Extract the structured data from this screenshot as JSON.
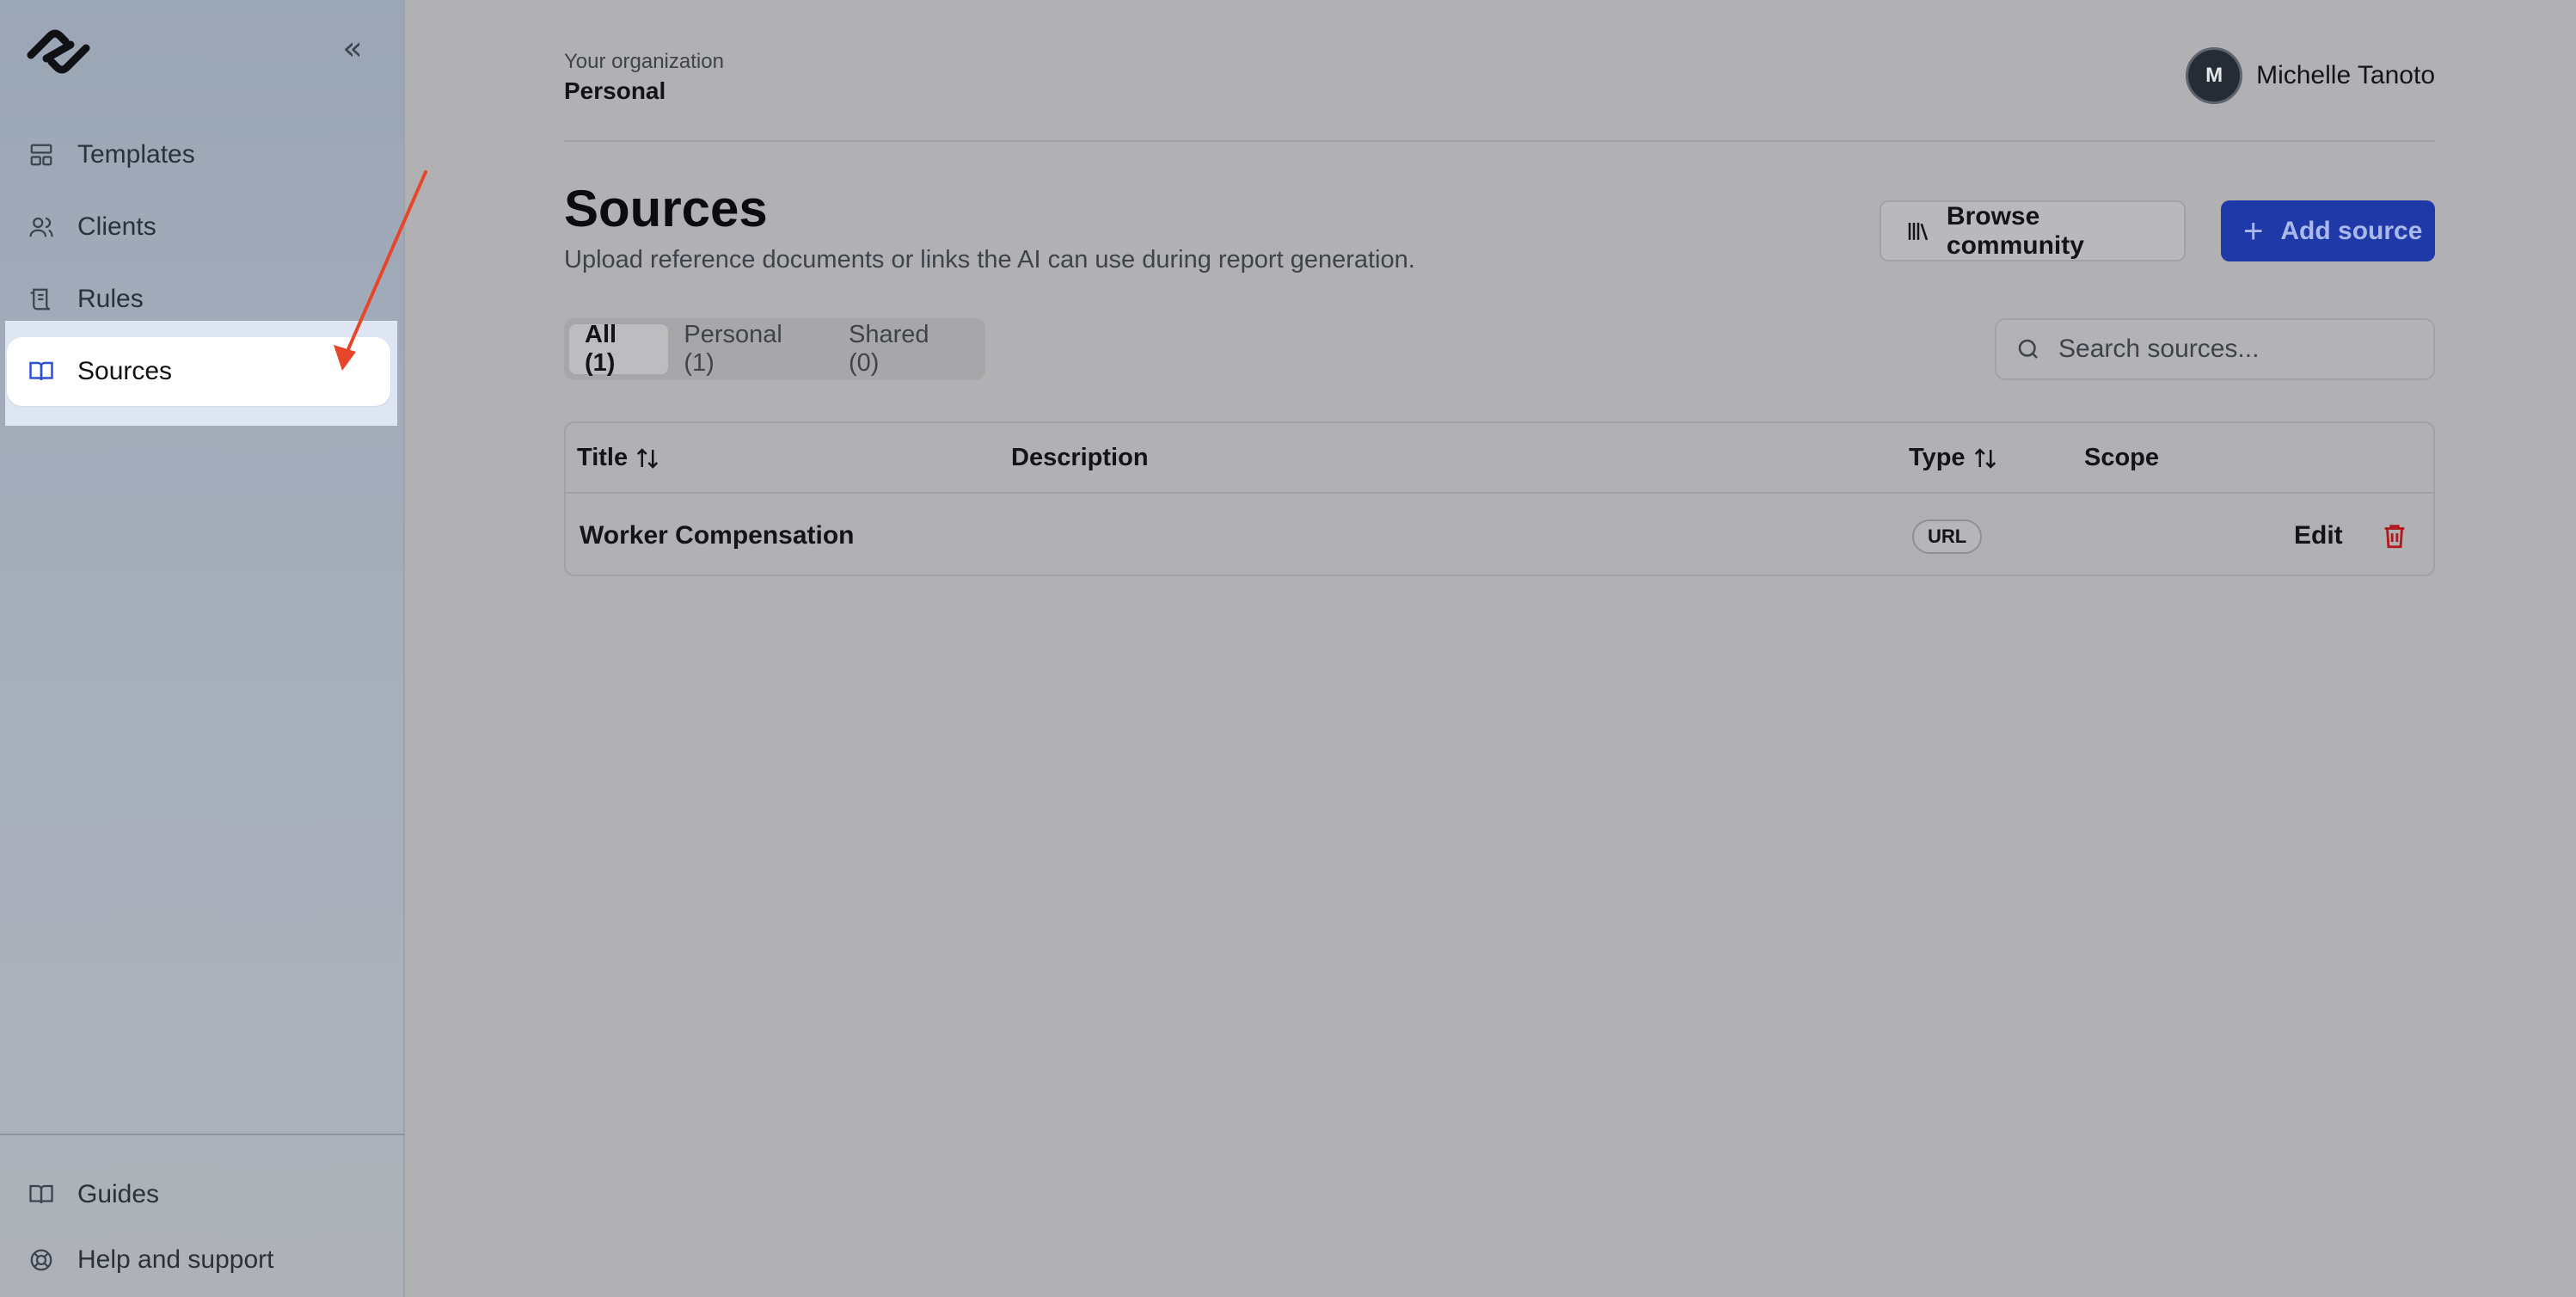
{
  "sidebar": {
    "logo": "brand-logo",
    "collapse_icon": "«",
    "items": [
      {
        "label": "Templates",
        "icon": "layout-icon"
      },
      {
        "label": "Clients",
        "icon": "users-icon"
      },
      {
        "label": "Rules",
        "icon": "scroll-icon"
      },
      {
        "label": "Sources",
        "icon": "book-icon",
        "active": true
      }
    ],
    "footer_items": [
      {
        "label": "Guides",
        "icon": "book-icon"
      },
      {
        "label": "Help and support",
        "icon": "lifebuoy-icon"
      }
    ]
  },
  "header": {
    "org_label": "Your organization",
    "org_name": "Personal",
    "user_initial": "M",
    "user_name": "Michelle Tanoto"
  },
  "page": {
    "title": "Sources",
    "subtitle": "Upload reference documents or links the AI can use during report generation.",
    "browse_label": "Browse community",
    "add_label": "Add source",
    "add_icon": "+"
  },
  "tabs": [
    {
      "label": "All (1)",
      "active": true
    },
    {
      "label": "Personal (1)"
    },
    {
      "label": "Shared (0)"
    }
  ],
  "search": {
    "placeholder": "Search sources..."
  },
  "table": {
    "columns": {
      "title": "Title",
      "description": "Description",
      "type": "Type",
      "scope": "Scope"
    },
    "rows": [
      {
        "title": "Worker Compensation",
        "description": "",
        "type": "URL",
        "scope": "",
        "edit": "Edit"
      }
    ]
  },
  "colors": {
    "accent": "#1f3aa8",
    "danger": "#b3161c",
    "annotation_arrow": "#e8462b"
  }
}
